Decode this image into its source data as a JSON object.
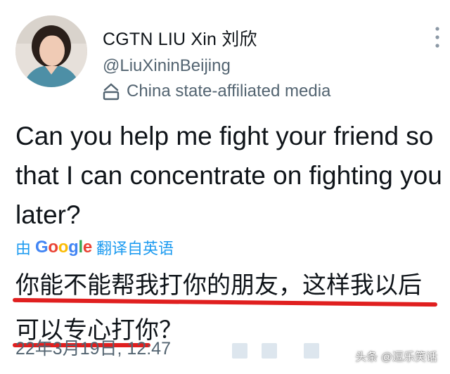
{
  "user": {
    "display_name": "CGTN LIU Xin 刘欣",
    "handle": "@LiuXininBeijing",
    "affiliation": "China state-affiliated media"
  },
  "tweet": {
    "text": "Can you help me fight your friend so that I can concentrate on fighting you later?",
    "translate_prefix": "由",
    "translate_brand": "Google",
    "translate_suffix": "翻译自英语",
    "translated_text": "你能不能帮我打你的朋友，这样我以后可以专心打你？",
    "timestamp": "22年3月19日, 12:47"
  },
  "watermark": "头条 @逗乐笑话",
  "colors": {
    "link": "#1d9bf0",
    "underline": "#e01f1f",
    "secondary_text": "#536471"
  },
  "icons": [
    "avatar",
    "building-icon",
    "more-options-icon"
  ]
}
